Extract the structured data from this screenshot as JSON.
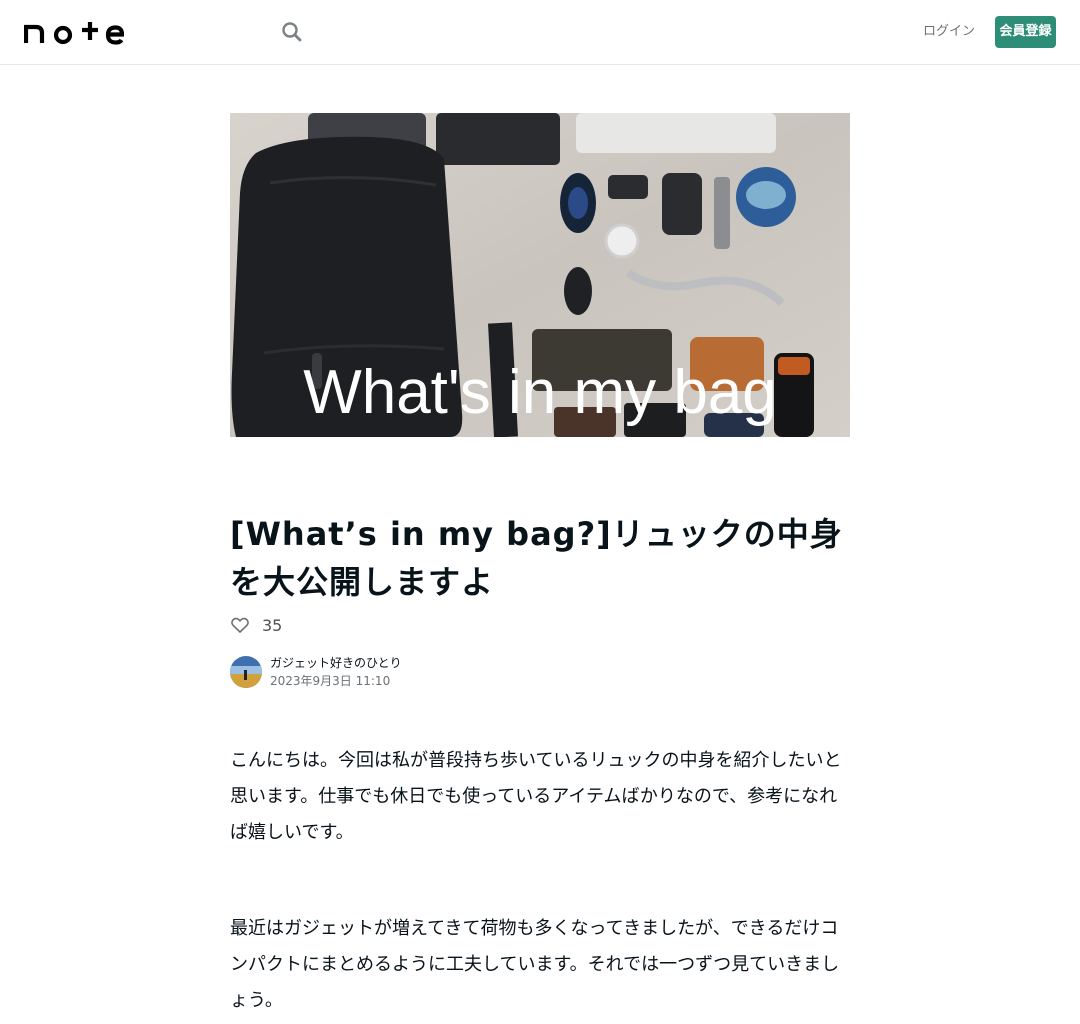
{
  "header": {
    "logo_text": "note",
    "search_icon": "search-icon",
    "login_label": "ログイン",
    "signup_label": "会員登録",
    "accent_color": "#2d8d76"
  },
  "hero": {
    "overlay_text": "What's in my bag"
  },
  "article": {
    "title": "[What’s in my bag?]リュックの中身を大公開しますよ",
    "like_icon": "heart-icon",
    "like_count": "35",
    "author_name": "ガジェット好きのひとり",
    "date": "2023年9月3日 11:10",
    "paragraphs": [
      "こんにちは。今回は私が普段持ち歩いているリュックの中身を紹介したいと思います。仕事でも休日でも使っているアイテムばかりなので、参考になれば嬉しいです。",
      "最近はガジェットが増えてきて荷物も多くなってきましたが、できるだけコンパクトにまとめるように工夫しています。それでは一つずつ見ていきましょう。"
    ]
  }
}
